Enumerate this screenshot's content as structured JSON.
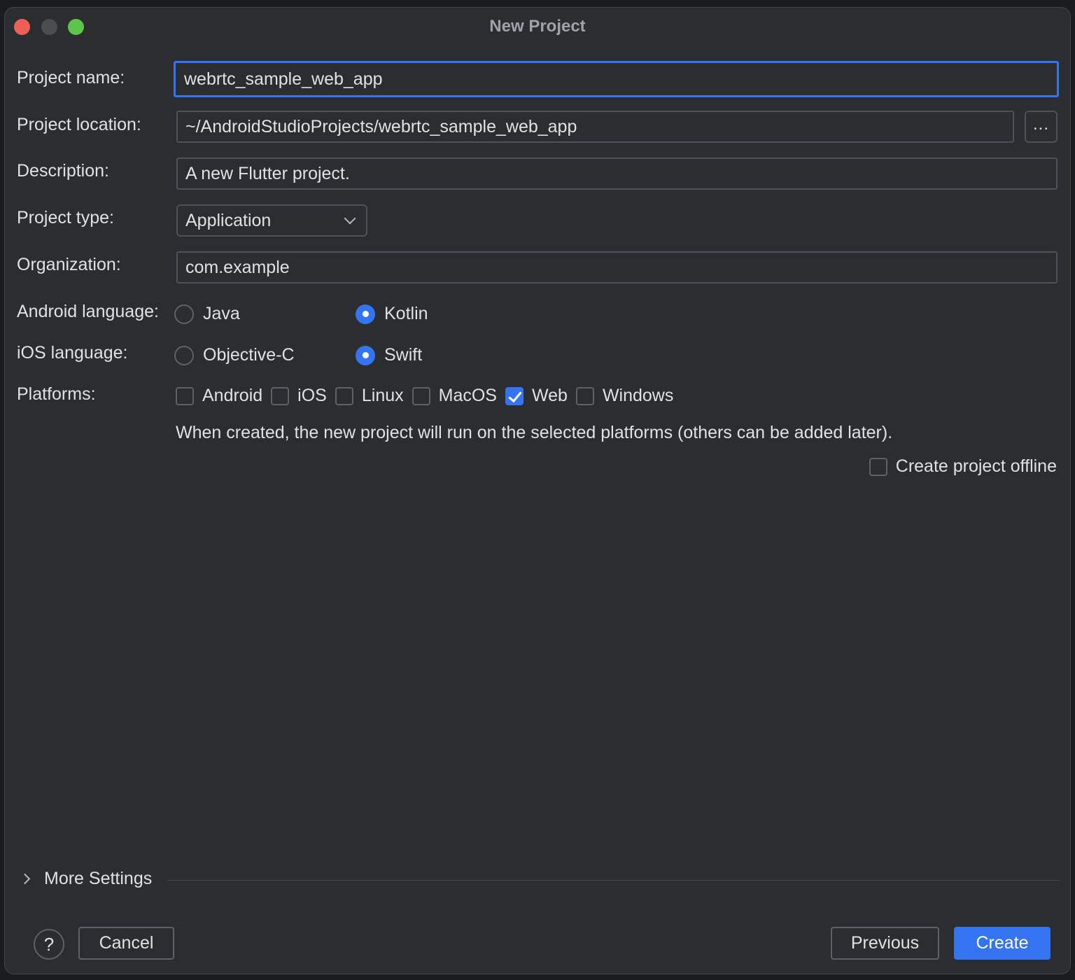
{
  "window": {
    "title": "New Project"
  },
  "form": {
    "project_name": {
      "label": "Project name:",
      "value": "webrtc_sample_web_app"
    },
    "project_location": {
      "label": "Project location:",
      "value": "~/AndroidStudioProjects/webrtc_sample_web_app",
      "browse_label": "..."
    },
    "description": {
      "label": "Description:",
      "value": "A new Flutter project."
    },
    "project_type": {
      "label": "Project type:",
      "selected": "Application"
    },
    "organization": {
      "label": "Organization:",
      "value": "com.example"
    },
    "android_language": {
      "label": "Android language:",
      "options": [
        "Java",
        "Kotlin"
      ],
      "selected": "Kotlin"
    },
    "ios_language": {
      "label": "iOS language:",
      "options": [
        "Objective-C",
        "Swift"
      ],
      "selected": "Swift"
    },
    "platforms": {
      "label": "Platforms:",
      "items": [
        {
          "label": "Android",
          "checked": false
        },
        {
          "label": "iOS",
          "checked": false
        },
        {
          "label": "Linux",
          "checked": false
        },
        {
          "label": "MacOS",
          "checked": false
        },
        {
          "label": "Web",
          "checked": true
        },
        {
          "label": "Windows",
          "checked": false
        }
      ],
      "hint": "When created, the new project will run on the selected platforms (others can be added later)."
    },
    "offline": {
      "label": "Create project offline",
      "checked": false
    }
  },
  "more_settings": {
    "label": "More Settings"
  },
  "footer": {
    "help_label": "?",
    "cancel_label": "Cancel",
    "previous_label": "Previous",
    "create_label": "Create"
  },
  "colors": {
    "background": "#2b2d30",
    "accent": "#3574f0",
    "close": "#ee5f57",
    "maximize": "#5ec54b"
  }
}
